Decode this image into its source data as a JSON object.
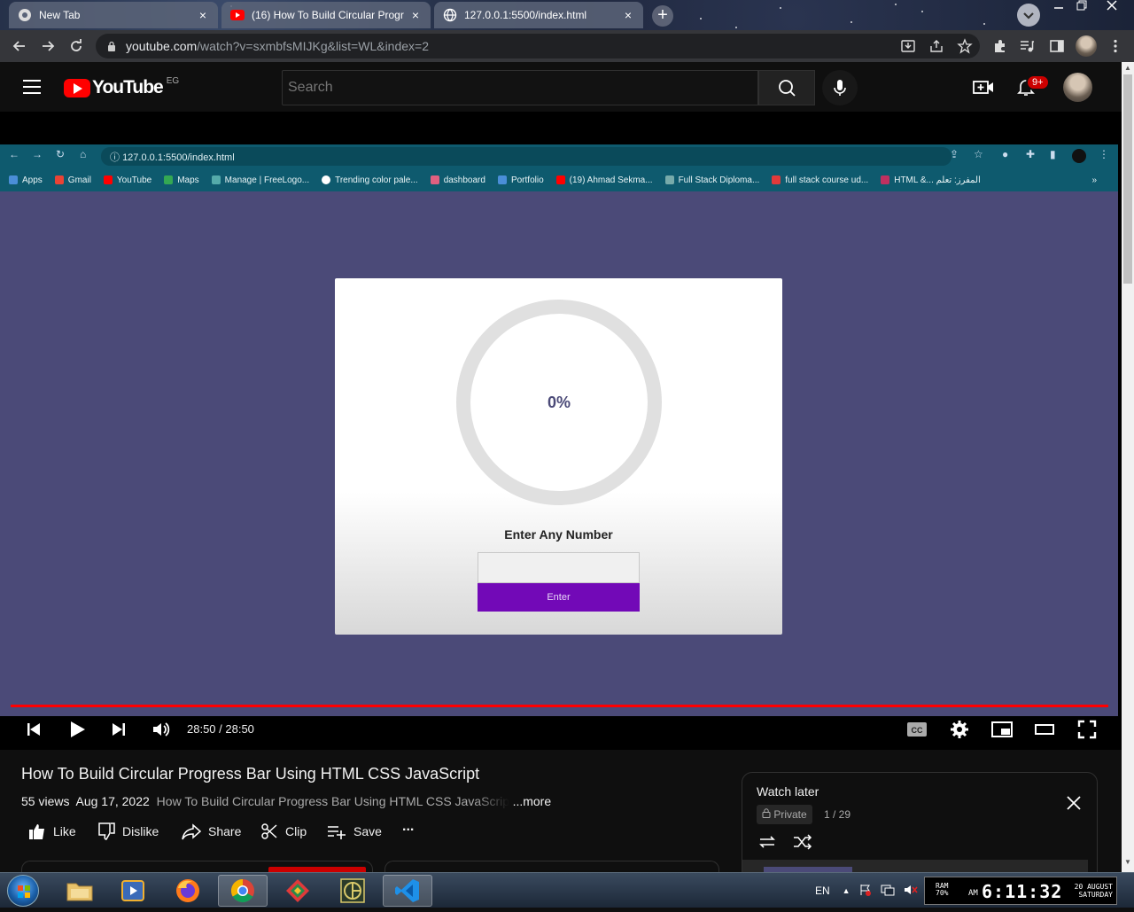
{
  "browser": {
    "tabs": [
      {
        "title": "New Tab",
        "close": "×"
      },
      {
        "title": "(16) How To Build Circular Progr",
        "close": "×"
      },
      {
        "title": "127.0.0.1:5500/index.html",
        "close": "×"
      }
    ],
    "new_tab": "+",
    "address": {
      "domain": "youtube.com",
      "path": "/watch?v=sxmbfsMIJKg&list=WL&index=2"
    }
  },
  "youtube": {
    "logo_text": "YouTube",
    "country": "EG",
    "search_placeholder": "Search",
    "notification_count": "9+"
  },
  "inner_browser": {
    "address": "127.0.0.1:5500/index.html",
    "bookmarks": [
      "Apps",
      "Gmail",
      "YouTube",
      "Maps",
      "Manage | FreeLogo...",
      "Trending color pale...",
      "dashboard",
      "Portfolio",
      "(19) Ahmad Sekma...",
      "Full Stack Diploma...",
      "full stack course ud...",
      "HTML &... المفرز: تعلم"
    ],
    "more": "»"
  },
  "demo": {
    "percent": "0%",
    "progress": 0,
    "label": "Enter Any Number",
    "button": "Enter"
  },
  "player": {
    "time": "28:50 / 28:50",
    "progress": 1.0
  },
  "video": {
    "title": "How To Build Circular Progress Bar Using HTML CSS JavaScript",
    "views": "55 views",
    "date": "Aug 17, 2022",
    "description": "How To Build Circular Progress Bar Using HTML CSS JavaScript",
    "more": "...more",
    "actions": {
      "like": "Like",
      "dislike": "Dislike",
      "share": "Share",
      "clip": "Clip",
      "save": "Save",
      "more": "..."
    }
  },
  "playlist": {
    "title": "Watch later",
    "privacy": "Private",
    "count": "1 / 29"
  },
  "taskbar": {
    "lang": "EN",
    "ram_label": "RAM",
    "ram_value": "70%",
    "ampm": "AM",
    "time": "6:11:32",
    "date_line1": "20 AUGUST",
    "date_line2": "SATURDAY"
  },
  "colors": {
    "yt_red": "#ff0000",
    "inner_bg": "#4b4a78",
    "enter_button": "#7209b7"
  }
}
